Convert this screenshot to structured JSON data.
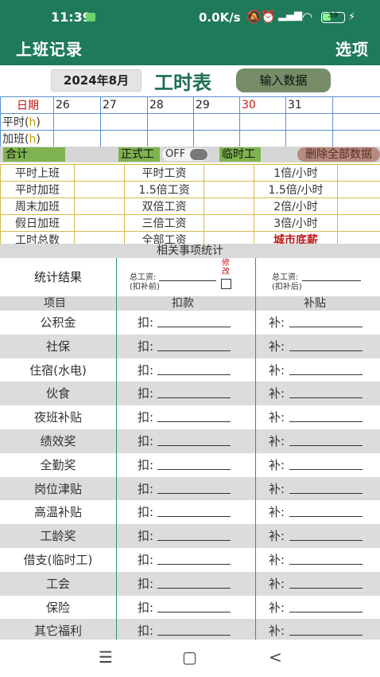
{
  "status_bar": {
    "time": "11:39",
    "network_speed": "0.0K/s",
    "battery_level": "39"
  },
  "app_bar": {
    "title": "上班记录",
    "options_label": "选项"
  },
  "toolbar": {
    "month_label": "2024年8月",
    "sheet_title": "工时表",
    "input_button_label": "输入数据"
  },
  "date_grid": {
    "date_label": "日期",
    "normal_label": "平时(",
    "overtime_label": "加班(",
    "hour_unit": "h",
    "close_paren": ")",
    "days": [
      "26",
      "27",
      "28",
      "29",
      "30",
      "31",
      ""
    ]
  },
  "summary": {
    "total_label": "合计",
    "formal_label": "正式工",
    "toggle_label": "OFF",
    "temp_label": "临时工",
    "delete_all_label": "删除全部数据"
  },
  "wage_rows": [
    [
      "平时上班",
      "",
      "平时工资",
      "",
      "1倍/小时",
      ""
    ],
    [
      "平时加班",
      "",
      "1.5倍工资",
      "",
      "1.5倍/小时",
      ""
    ],
    [
      "周末加班",
      "",
      "双倍工资",
      "",
      "2倍/小时",
      ""
    ],
    [
      "假日加班",
      "",
      "三倍工资",
      "",
      "3倍/小时",
      ""
    ],
    [
      "工时总数",
      "",
      "全部工资",
      "",
      "城市底薪",
      ""
    ]
  ],
  "stats": {
    "header": "相关事项统计",
    "result_label": "统计结果",
    "total_wage_before_label": "总工资:",
    "before_deduction_label": "(扣补前)",
    "modify_label": "修改",
    "total_wage_after_label": "总工资:",
    "after_deduction_label": "(扣补后)"
  },
  "item_header": {
    "item": "项目",
    "deduction": "扣款",
    "subsidy": "补贴"
  },
  "deduct_prefix": "扣:",
  "add_prefix": "补:",
  "items": [
    "公积金",
    "社保",
    "住宿(水电)",
    "伙食",
    "夜班补贴",
    "绩效奖",
    "全勤奖",
    "岗位津贴",
    "高温补贴",
    "工龄奖",
    "借支(临时工)",
    "工会",
    "保险",
    "其它福利"
  ],
  "nav": {
    "menu_glyph": "☰",
    "home_glyph": "▢",
    "back_glyph": "<"
  }
}
